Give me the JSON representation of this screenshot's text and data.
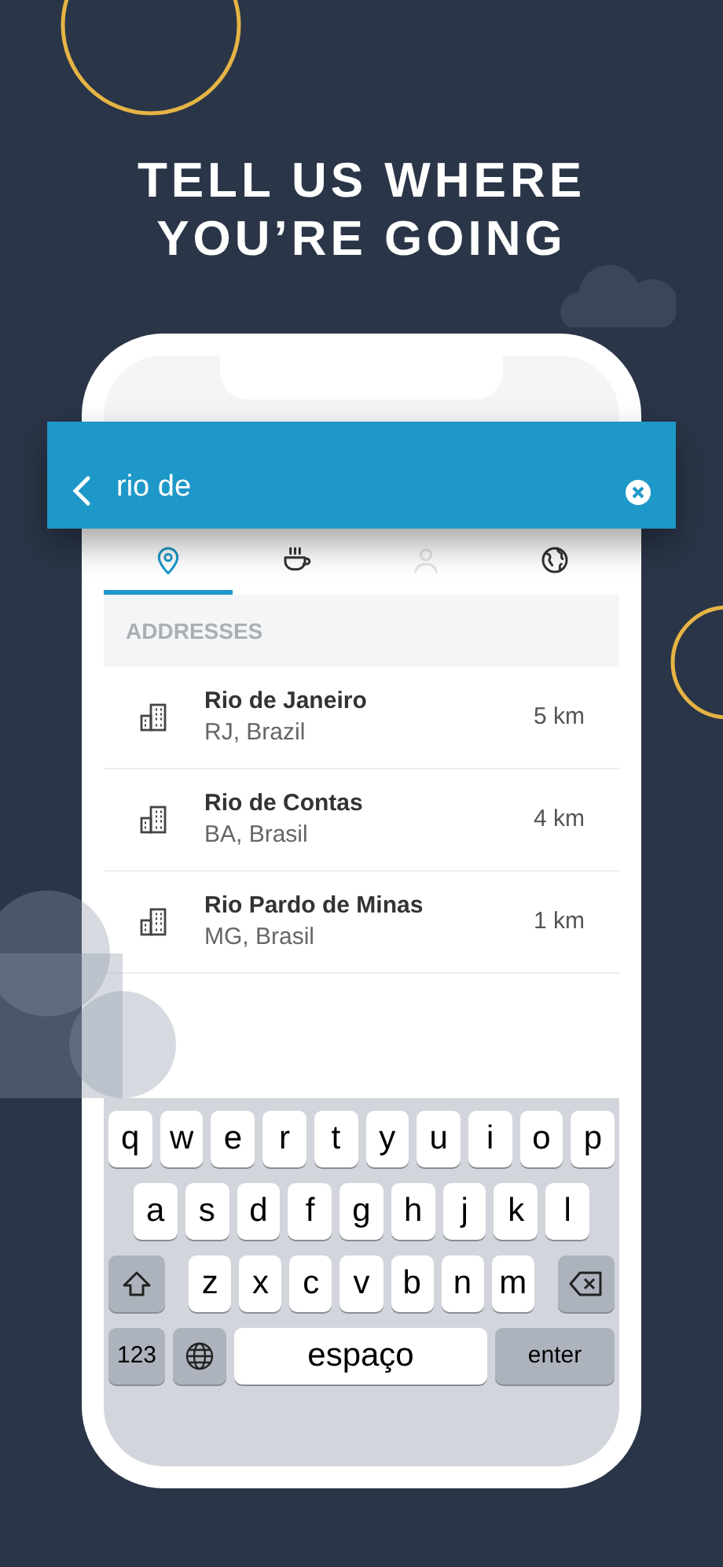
{
  "headline": [
    "TELL US WHERE",
    "YOU’RE GOING"
  ],
  "search": {
    "value": "rio de"
  },
  "tabs": [
    {
      "kind": "pin",
      "selected": true,
      "disabled": false
    },
    {
      "kind": "coffee",
      "selected": false,
      "disabled": false
    },
    {
      "kind": "person",
      "selected": false,
      "disabled": true
    },
    {
      "kind": "globe",
      "selected": false,
      "disabled": false
    }
  ],
  "section_header": "ADDRESSES",
  "results": [
    {
      "title": "Rio de Janeiro",
      "subtitle": "RJ, Brazil",
      "distance": "5 km"
    },
    {
      "title": "Rio de Contas",
      "subtitle": "BA, Brasil",
      "distance": "4 km"
    },
    {
      "title": "Rio Pardo de Minas",
      "subtitle": "MG, Brasil",
      "distance": "1 km"
    }
  ],
  "keyboard": {
    "rows": [
      [
        "q",
        "w",
        "e",
        "r",
        "t",
        "y",
        "u",
        "i",
        "o",
        "p"
      ],
      [
        "a",
        "s",
        "d",
        "f",
        "g",
        "h",
        "j",
        "k",
        "l"
      ],
      [
        "z",
        "x",
        "c",
        "v",
        "b",
        "n",
        "m"
      ]
    ],
    "numbers_key": "123",
    "space_key": "espaço",
    "enter_key": "enter"
  }
}
